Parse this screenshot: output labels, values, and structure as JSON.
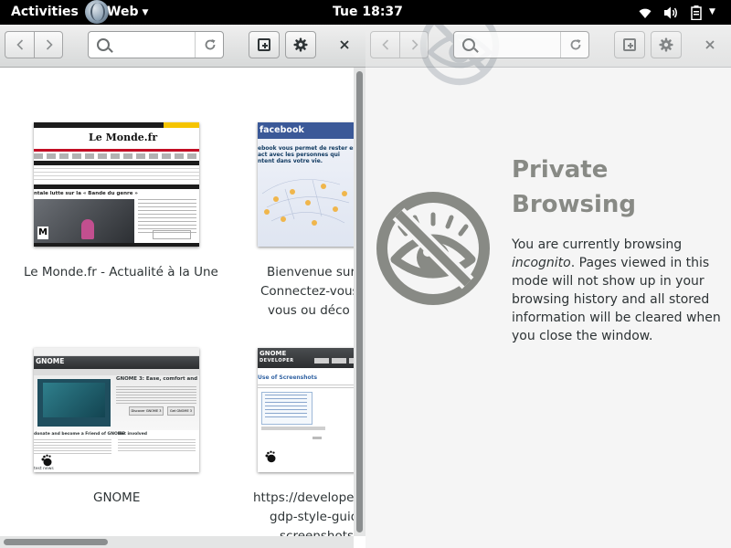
{
  "topbar": {
    "activities": "Activities",
    "app_name": "Web",
    "clock": "Tue 18:37",
    "icons": [
      "web-browser-icon",
      "wifi-icon",
      "volume-icon",
      "battery-icon"
    ]
  },
  "left_window": {
    "url_placeholder": "",
    "tiles": [
      {
        "title_lines": [
          "Le Monde.fr - Actualité à la Une"
        ],
        "site": "Le Monde"
      },
      {
        "title_lines": [
          "Bienvenue sur",
          "Connectez-vous",
          "vous ou déco"
        ],
        "site": "facebook"
      },
      {
        "title_lines": [
          "GNOME"
        ],
        "site": "GNOME"
      },
      {
        "title_lines": [
          "https://develope",
          "gdp-style-guid",
          "screenshots."
        ],
        "site": "GNOME DEVELOPER"
      }
    ],
    "thumb_text": {
      "lemonde_logo": "Le Monde.fr",
      "lemonde_headline": "ntale lutte sur la « Bande du genre »",
      "facebook_logo": "facebook",
      "facebook_text_1": "ebook vous permet de rester en",
      "facebook_text_2": "act avec les personnes qui",
      "facebook_text_3": "ntent dans votre vie.",
      "gnome_logo": "GNOME",
      "gnome_headline": "GNOME 3: Ease, comfort and control",
      "gnome_donate": "donate and become a Friend of GNOME",
      "gnome_involved": "Get involved",
      "gnome_btn_1": "Discover GNOME 3",
      "gnome_btn_2": "Get GNOME 3",
      "gnome_news": "test news",
      "dev_logo": "GNOME",
      "dev_logo_sub": "DEVELOPER",
      "dev_heading": "Use of Screenshots"
    }
  },
  "right_window": {
    "title_line1": "Private",
    "title_line2": "Browsing",
    "text_before": "You are currently browsing ",
    "text_italic": "incognito",
    "text_after": ". Pages viewed in this mode will not show up in your browsing history and all stored information will be cleared when you close the window."
  },
  "colors": {
    "topbar_bg": "#000000",
    "headerbar": "#dcdede",
    "private_bg": "#f5f5f5",
    "private_icon": "#888a85",
    "facebook_blue": "#3b5998",
    "lemonde_red": "#c30e25"
  }
}
